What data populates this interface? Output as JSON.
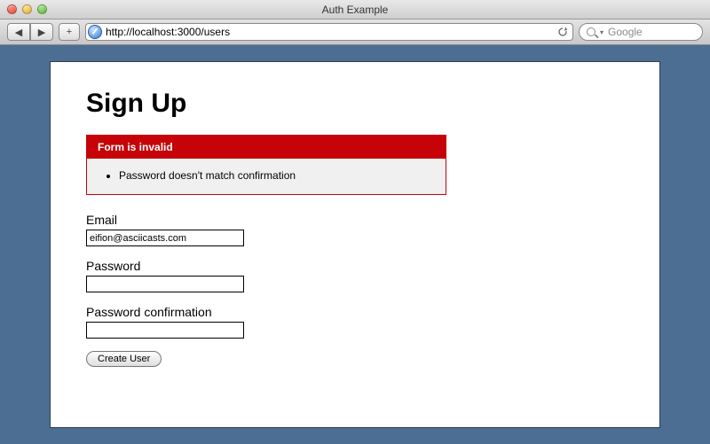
{
  "window": {
    "title": "Auth Example"
  },
  "toolbar": {
    "url": "http://localhost:3000/users",
    "search_placeholder": "Google"
  },
  "page": {
    "heading": "Sign Up",
    "error": {
      "title": "Form is invalid",
      "messages": [
        "Password doesn't match confirmation"
      ]
    },
    "fields": {
      "email": {
        "label": "Email",
        "value": "eifion@asciicasts.com"
      },
      "password": {
        "label": "Password",
        "value": ""
      },
      "password_confirmation": {
        "label": "Password confirmation",
        "value": ""
      }
    },
    "submit_label": "Create User"
  }
}
